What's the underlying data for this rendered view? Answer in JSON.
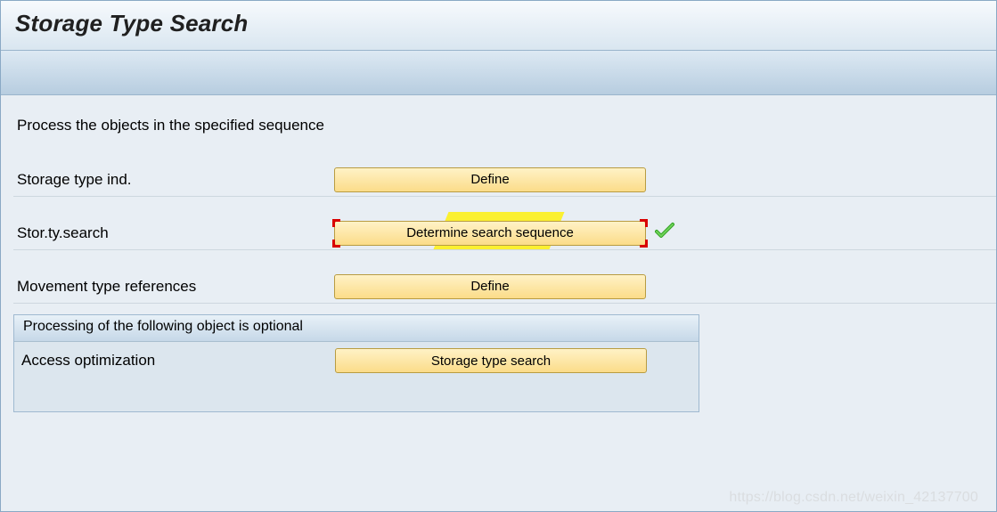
{
  "title": "Storage Type Search",
  "instruction": "Process the objects in the specified sequence",
  "rows": [
    {
      "label": "Storage type ind.",
      "button": "Define"
    },
    {
      "label": "Stor.ty.search",
      "button": "Determine search sequence"
    },
    {
      "label": "Movement type references",
      "button": "Define"
    }
  ],
  "optional": {
    "header": "Processing of the following object is optional",
    "row": {
      "label": "Access optimization",
      "button": "Storage type search"
    }
  },
  "watermark": "https://blog.csdn.net/weixin_42137700"
}
